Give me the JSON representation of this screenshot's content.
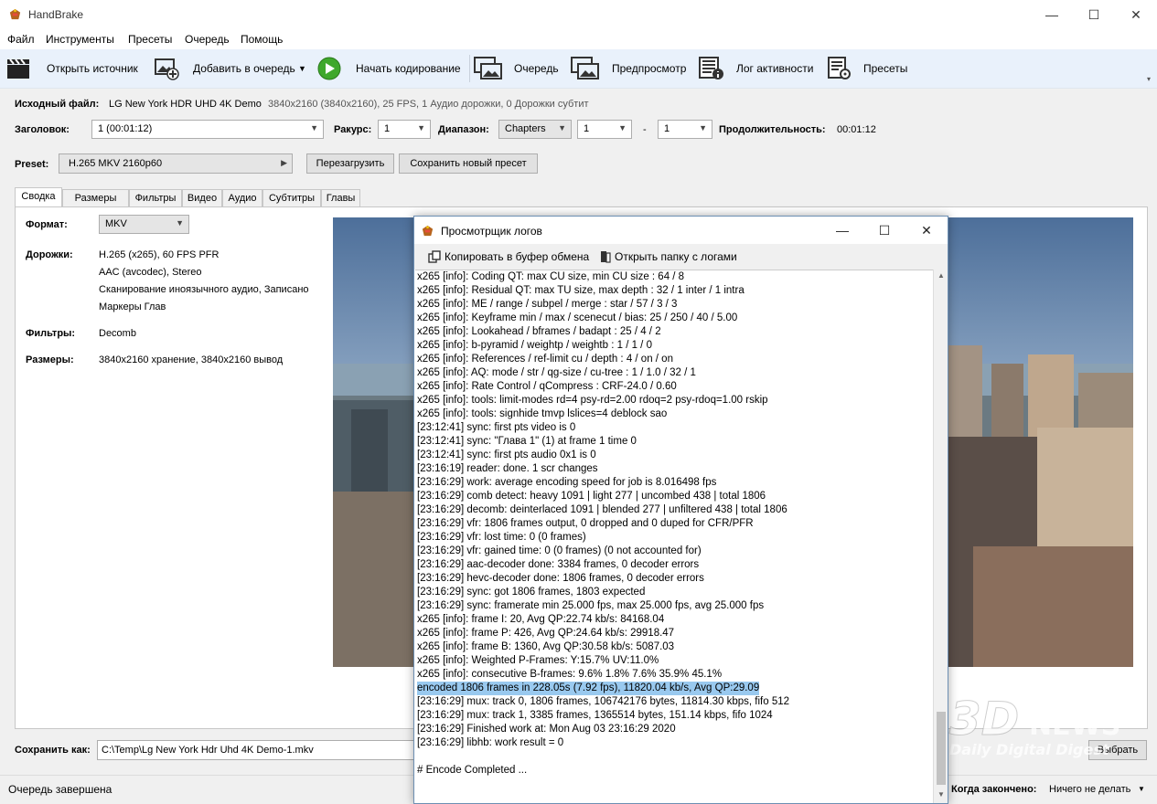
{
  "app": {
    "title": "HandBrake"
  },
  "menu": [
    "Файл",
    "Инструменты",
    "Пресеты",
    "Очередь",
    "Помощь"
  ],
  "toolbar": {
    "open_source": "Открыть источник",
    "add_queue": "Добавить в очередь",
    "start": "Начать кодирование",
    "queue": "Очередь",
    "preview": "Предпросмотр",
    "activity_log": "Лог активности",
    "presets": "Пресеты"
  },
  "source": {
    "label": "Исходный файл:",
    "name": "LG New York HDR UHD 4K Demo",
    "info": "3840x2160 (3840x2160), 25 FPS, 1 Аудио дорожки, 0 Дорожки субтит"
  },
  "title_row": {
    "title_label": "Заголовок:",
    "title_value": "1  (00:01:12)",
    "angle_label": "Ракурс:",
    "angle_value": "1",
    "range_label": "Диапазон:",
    "range_mode": "Chapters",
    "range_from": "1",
    "range_dash": "-",
    "range_to": "1",
    "duration_label": "Продолжительность:",
    "duration_value": "00:01:12"
  },
  "preset": {
    "label": "Preset:",
    "value": "H.265 MKV 2160p60",
    "reload": "Перезагрузить",
    "save_new": "Сохранить новый пресет"
  },
  "tabs": [
    "Сводка",
    "Размеры",
    "Фильтры",
    "Видео",
    "Аудио",
    "Субтитры",
    "Главы"
  ],
  "summary": {
    "format_label": "Формат:",
    "format_value": "MKV",
    "tracks_label": "Дорожки:",
    "tracks": [
      "H.265 (x265), 60 FPS PFR",
      "AAC (avcodec), Stereo",
      "Сканирование иноязычного аудио, Записано",
      "Маркеры Глав"
    ],
    "filters_label": "Фильтры:",
    "filters_value": "Decomb",
    "size_label": "Размеры:",
    "size_value": "3840x2160 хранение, 3840x2160 вывод"
  },
  "save": {
    "label": "Сохранить как:",
    "path": "C:\\Temp\\Lg New York Hdr Uhd 4K Demo-1.mkv",
    "browse": "Выбрать"
  },
  "status": {
    "text": "Очередь завершена",
    "when_done_label": "Когда закончено:",
    "when_done_value": "Ничего не делать"
  },
  "log_window": {
    "title": "Просмотрщик логов",
    "copy": "Копировать в буфер обмена",
    "open_folder": "Открыть папку с логами",
    "lines": [
      "x265 [info]: Coding QT: max CU size, min CU size : 64 / 8",
      "x265 [info]: Residual QT: max TU size, max depth : 32 / 1 inter / 1 intra",
      "x265 [info]: ME / range / subpel / merge        : star / 57 / 3 / 3",
      "x265 [info]: Keyframe min / max / scenecut / bias: 25 / 250 / 40 / 5.00",
      "x265 [info]: Lookahead / bframes / badapt       : 25 / 4 / 2",
      "x265 [info]: b-pyramid / weightp / weightb      : 1 / 1 / 0",
      "x265 [info]: References / ref-limit  cu / depth  : 4 / on / on",
      "x265 [info]: AQ: mode / str / qg-size / cu-tree  : 1 / 1.0 / 32 / 1",
      "x265 [info]: Rate Control / qCompress          : CRF-24.0 / 0.60",
      "x265 [info]: tools: limit-modes rd=4 psy-rd=2.00 rdoq=2 psy-rdoq=1.00 rskip",
      "x265 [info]: tools: signhide tmvp lslices=4 deblock sao",
      "[23:12:41] sync: first pts video is 0",
      "[23:12:41] sync: \"Глава 1\" (1) at frame 1 time 0",
      "[23:12:41] sync: first pts audio 0x1 is 0",
      "[23:16:19] reader: done. 1 scr changes",
      "[23:16:29] work: average encoding speed for job is 8.016498 fps",
      "[23:16:29] comb detect: heavy 1091 | light 277 | uncombed 438 | total 1806",
      "[23:16:29] decomb: deinterlaced 1091 | blended 277 | unfiltered 438 | total 1806",
      "[23:16:29] vfr: 1806 frames output, 0 dropped and 0 duped for CFR/PFR",
      "[23:16:29] vfr: lost time: 0 (0 frames)",
      "[23:16:29] vfr: gained time: 0 (0 frames) (0 not accounted for)",
      "[23:16:29] aac-decoder done: 3384 frames, 0 decoder errors",
      "[23:16:29] hevc-decoder done: 1806 frames, 0 decoder errors",
      "[23:16:29] sync: got 1806 frames, 1803 expected",
      "[23:16:29] sync: framerate min 25.000 fps, max 25.000 fps, avg 25.000 fps",
      "x265 [info]: frame I:     20, Avg QP:22.74  kb/s: 84168.04",
      "x265 [info]: frame P:    426, Avg QP:24.64  kb/s: 29918.47",
      "x265 [info]: frame B:   1360, Avg QP:30.58  kb/s: 5087.03",
      "x265 [info]: Weighted P-Frames: Y:15.7% UV:11.0%",
      "x265 [info]: consecutive B-frames: 9.6% 1.8% 7.6% 35.9% 45.1%",
      "encoded 1806 frames in 228.05s (7.92 fps), 11820.04 kb/s, Avg QP:29.09",
      "[23:16:29] mux: track 0, 1806 frames, 106742176 bytes, 11814.30 kbps, fifo 512",
      "[23:16:29] mux: track 1, 3385 frames, 1365514 bytes, 151.14 kbps, fifo 1024",
      "[23:16:29] Finished work at: Mon Aug 03 23:16:29 2020",
      "[23:16:29] libhb: work result = 0",
      "",
      "# Encode Completed ..."
    ],
    "highlight_index": 30
  },
  "watermark": {
    "brand": "3DNEWS",
    "tagline": "Daily Digital Digest"
  },
  "colors": {
    "toolbar_bg": "#e9f1fb",
    "highlight": "#99c9ef",
    "play_green": "#3fa82c"
  }
}
